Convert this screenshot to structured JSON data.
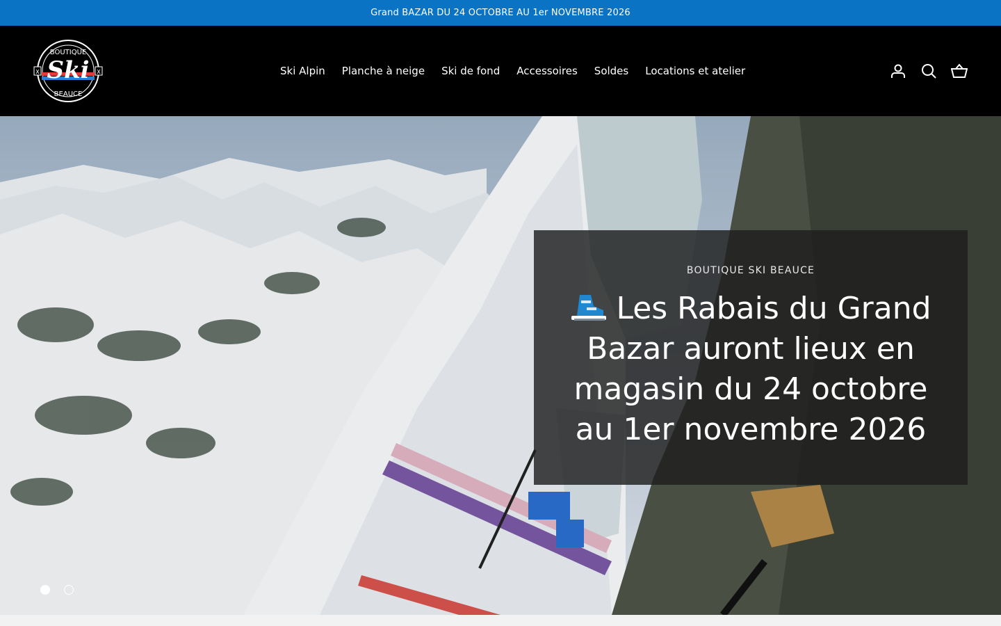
{
  "announcement": {
    "text": "Grand BAZAR DU 24 OCTOBRE AU 1er NOVEMBRE 2026"
  },
  "header": {
    "logo": {
      "top_text": "BOUTIQUE",
      "main_text": "Ski",
      "bottom_text": "BEAUCE",
      "side_mark": "X"
    },
    "nav": [
      {
        "label": "Ski Alpin"
      },
      {
        "label": "Planche à neige"
      },
      {
        "label": "Ski de fond"
      },
      {
        "label": "Accessoires"
      },
      {
        "label": "Soldes"
      },
      {
        "label": "Locations et atelier"
      }
    ],
    "icons": [
      "account-icon",
      "search-icon",
      "cart-icon"
    ]
  },
  "hero": {
    "eyebrow": "BOUTIQUE SKI BEAUCE",
    "headline": "Les Rabais du Grand Bazar auront lieux en magasin du 24 octobre au 1er novembre 2026",
    "headline_emoji": "ski-boot-icon",
    "slides": 2,
    "active_slide": 1
  },
  "colors": {
    "announcement_bg": "#0a73c4",
    "header_bg": "#000000",
    "panel_bg": "rgba(30,30,30,0.82)"
  }
}
